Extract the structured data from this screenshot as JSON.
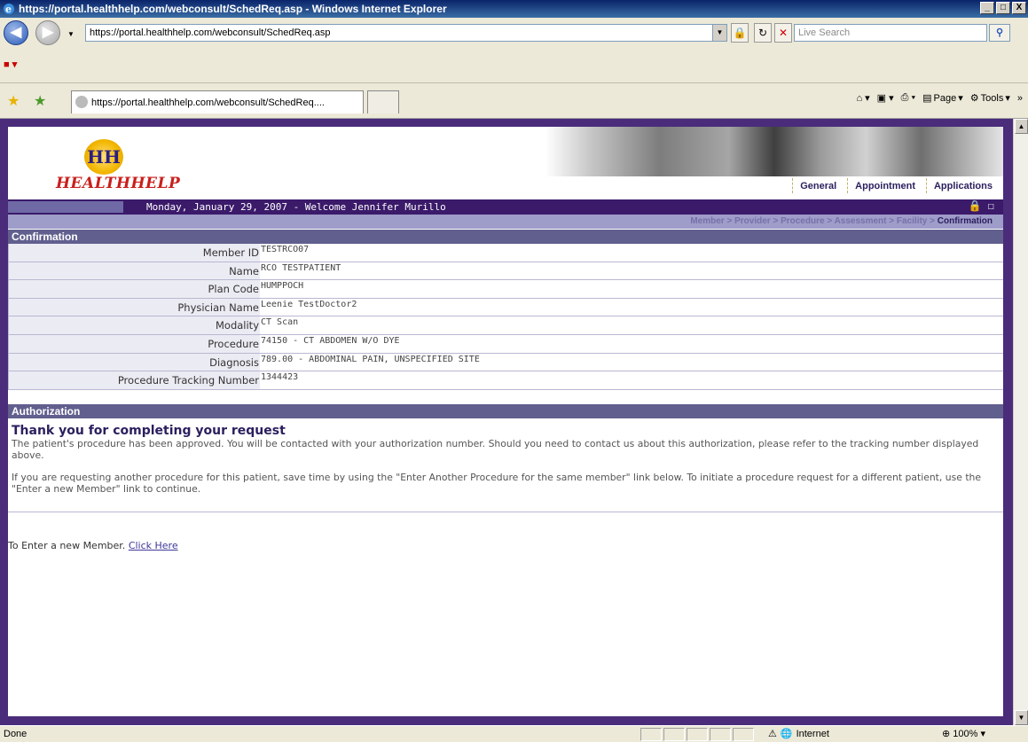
{
  "window": {
    "title": "https://portal.healthhelp.com/webconsult/SchedReq.asp - Windows Internet Explorer",
    "minimize": "_",
    "maximize": "□",
    "close": "X"
  },
  "addressbar": {
    "url": "https://portal.healthhelp.com/webconsult/SchedReq.asp",
    "search_placeholder": "Live Search"
  },
  "tabs": {
    "active_label": "https://portal.healthhelp.com/webconsult/SchedReq...."
  },
  "commandbar": {
    "page_label": "Page",
    "tools_label": "Tools"
  },
  "site": {
    "logo_text": "HEALTHHELP",
    "logo_mark": "HH",
    "nav": [
      "General",
      "Appointment",
      "Applications"
    ],
    "welcome": "Monday, January 29, 2007 - Welcome Jennifer Murillo",
    "breadcrumb": [
      "Member",
      "Provider",
      "Procedure",
      "Assessment",
      "Facility",
      "Confirmation"
    ],
    "breadcrumb_sep": " > "
  },
  "confirmation": {
    "heading": "Confirmation",
    "rows": [
      {
        "label": "Member ID",
        "value": "TESTRCO07"
      },
      {
        "label": "Name",
        "value": "RCO TESTPATIENT"
      },
      {
        "label": "Plan Code",
        "value": "HUMPPOCH"
      },
      {
        "label": "Physician Name",
        "value": "Leenie TestDoctor2"
      },
      {
        "label": "Modality",
        "value": "CT Scan"
      },
      {
        "label": "Procedure",
        "value": "74150 - CT ABDOMEN W/O DYE"
      },
      {
        "label": "Diagnosis",
        "value": "789.00 - ABDOMINAL PAIN, UNSPECIFIED SITE"
      },
      {
        "label": "Procedure Tracking Number",
        "value": "1344423"
      }
    ]
  },
  "authorization": {
    "heading": "Authorization",
    "title": "Thank you for completing your request",
    "paragraph1": "The patient's procedure has been approved. You will be contacted with your authorization number. Should you need to contact us about this authorization, please refer to the tracking number displayed above.",
    "paragraph2": "If you are requesting another procedure for this patient, save time by using the \"Enter Another Procedure for the same member\" link below. To initiate a procedure request for a different patient, use the \"Enter a new Member\" link to continue."
  },
  "new_member": {
    "text": "To Enter a new Member.",
    "link": "Click Here"
  },
  "statusbar": {
    "status": "Done",
    "zone": "Internet",
    "zoom": "100%"
  },
  "icons": [
    "back-icon",
    "forward-icon",
    "lock-icon",
    "refresh-icon",
    "stop-icon",
    "search-icon",
    "favorites-star-icon",
    "add-favorite-icon",
    "home-icon",
    "feeds-icon",
    "print-icon",
    "page-icon",
    "tools-icon",
    "padlock-icon",
    "mouse-icon",
    "globe-icon"
  ]
}
